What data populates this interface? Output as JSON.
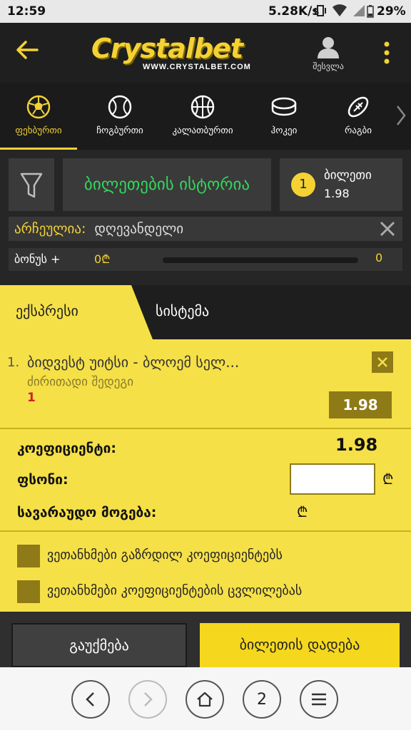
{
  "status": {
    "time": "12:59",
    "network_speed": "5.28K/s",
    "battery": "29%"
  },
  "header": {
    "brand": "Crystalbet",
    "brand_url": "WWW.CRYSTALBET.COM",
    "login_label": "შესვლა"
  },
  "sports": [
    {
      "label": "ფეხბურთი",
      "icon": "soccer-ball-icon",
      "active": true
    },
    {
      "label": "ჩოგბურთი",
      "icon": "tennis-ball-icon",
      "active": false
    },
    {
      "label": "კალათბურთი",
      "icon": "basketball-icon",
      "active": false
    },
    {
      "label": "ჰოკეი",
      "icon": "hockey-puck-icon",
      "active": false
    },
    {
      "label": "რაგბი",
      "icon": "rugby-ball-icon",
      "active": false
    }
  ],
  "toolbar": {
    "history_label": "ბილეთების ისტორია",
    "ticket_count": "1",
    "ticket_label": "ბილეთი",
    "ticket_odds": "1.98"
  },
  "archive": {
    "label": "არჩეულია:",
    "value": "დღევანდელი"
  },
  "bonus": {
    "label": "ბონუს +",
    "amount": "0₾",
    "progress": 0,
    "right_value": "0"
  },
  "tabs": {
    "express": "ექსპრესი",
    "system": "სისტემა"
  },
  "bet": {
    "index": "1.",
    "title": "ბიდვესტ უიტსი - ბლოემ სელ...",
    "market": "ძირითადი შედეგი",
    "pick": "1",
    "odds": "1.98"
  },
  "summary": {
    "coef_label": "კოეფიციენტი:",
    "coef_value": "1.98",
    "stake_label": "ფსონი:",
    "stake_value": "",
    "currency": "₾",
    "win_label": "სავარაუდო მოგება:",
    "win_value": "₾"
  },
  "checks": [
    {
      "label": "ვეთანხმები გაზრდილ კოეფიციენტებს"
    },
    {
      "label": "ვეთანხმები კოეფიციენტების ცვლილებას"
    }
  ],
  "actions": {
    "cancel": "გაუქმება",
    "place": "ბილეთის დადება"
  },
  "browser": {
    "tab_count": "2"
  },
  "colors": {
    "accent": "#f5d233",
    "panel": "#f5e048",
    "dark_btn": "#8e7a17",
    "history_green": "#33d65c"
  }
}
